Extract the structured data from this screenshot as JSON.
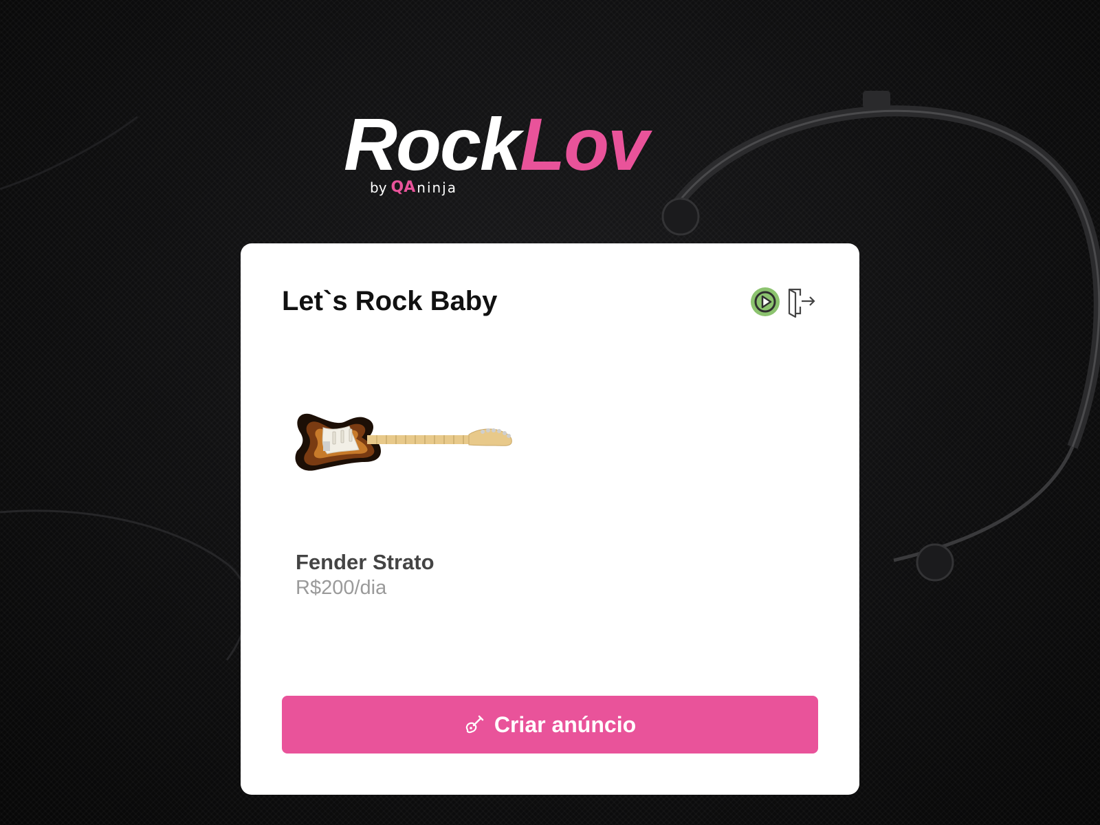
{
  "brand": {
    "word_primary": "Rock",
    "word_accent": "Lov",
    "by_text": "by",
    "qa_mark": "QA",
    "ninja_text": "ninja",
    "colors": {
      "accent": "#e9539a",
      "primary": "#ffffff"
    }
  },
  "dashboard": {
    "title": "Let`s Rock Baby",
    "actions": [
      {
        "icon": "play-circle-icon",
        "color": "#8cc36f"
      },
      {
        "icon": "logout-door-icon",
        "color": "#444444"
      }
    ]
  },
  "listings": [
    {
      "name": "Fender Strato",
      "price": "R$200/dia",
      "image_icon": "electric-guitar-image"
    }
  ],
  "create_button": {
    "label": "Criar anúncio",
    "icon": "guitar-icon",
    "color": "#e9539a"
  }
}
